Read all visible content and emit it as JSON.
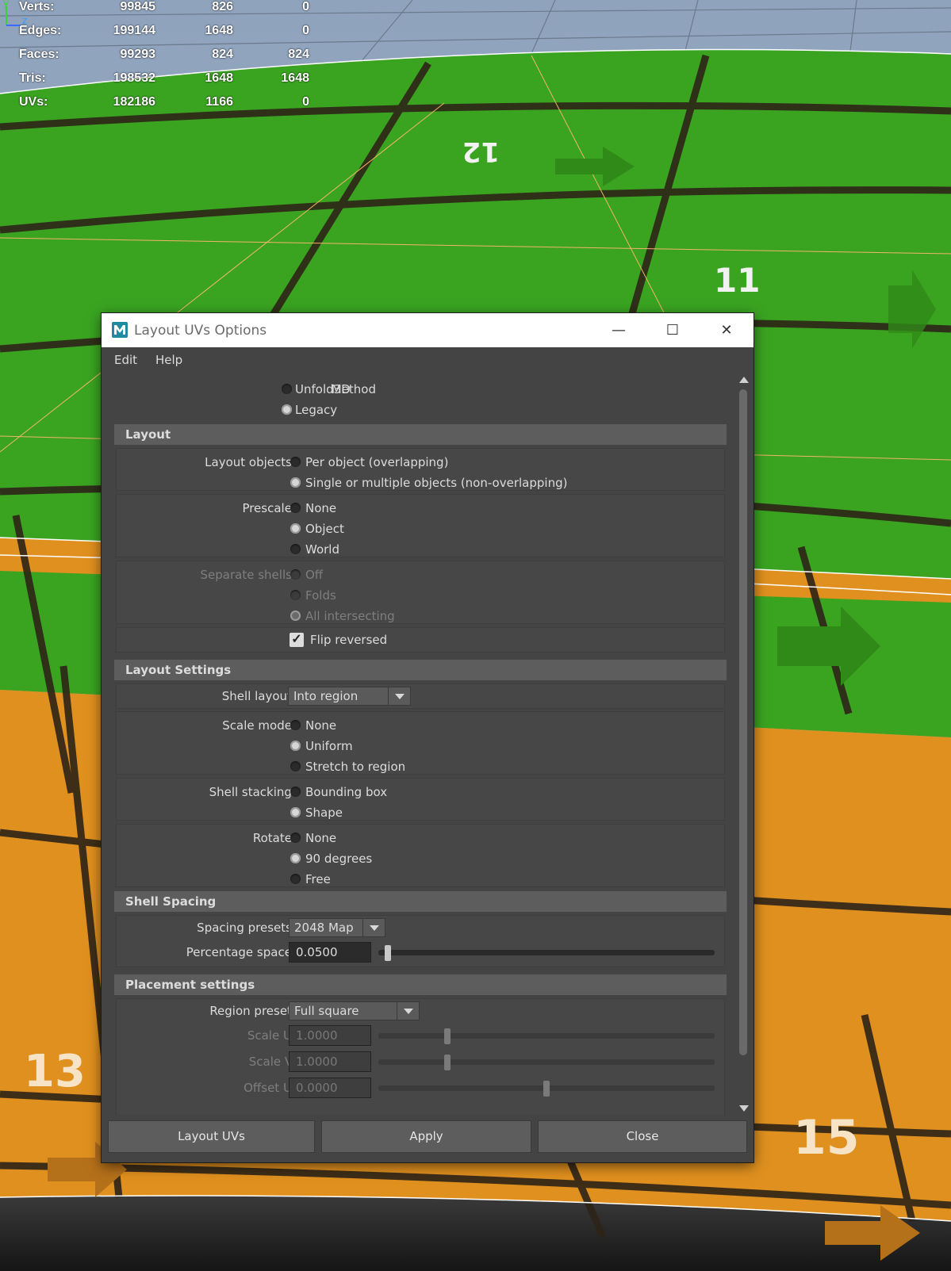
{
  "hud": {
    "rows": [
      {
        "label": "Verts:",
        "v1": "99845",
        "v2": "826",
        "v3": "0"
      },
      {
        "label": "Edges:",
        "v1": "199144",
        "v2": "1648",
        "v3": "0"
      },
      {
        "label": "Faces:",
        "v1": "99293",
        "v2": "824",
        "v3": "824"
      },
      {
        "label": "Tris:",
        "v1": "198532",
        "v2": "1648",
        "v3": "1648"
      },
      {
        "label": "UVs:",
        "v1": "182186",
        "v2": "1166",
        "v3": "0"
      }
    ]
  },
  "viewport": {
    "tile_labels": [
      "12",
      "11",
      "13",
      "15"
    ],
    "axis": {
      "y": "y",
      "z": "z"
    }
  },
  "dialog": {
    "title": "Layout UVs Options",
    "menu": [
      "Edit",
      "Help"
    ],
    "method": {
      "label": "Method",
      "options": [
        "Unfold3D",
        "Legacy"
      ],
      "selected": "Legacy"
    },
    "layout_section": "Layout",
    "layout_objects": {
      "label": "Layout objects:",
      "options": [
        "Per object (overlapping)",
        "Single or multiple objects (non-overlapping)"
      ],
      "selected": 1
    },
    "prescale": {
      "label": "Prescale:",
      "options": [
        "None",
        "Object",
        "World"
      ],
      "selected": 1
    },
    "separate_shells": {
      "label": "Separate shells:",
      "options": [
        "Off",
        "Folds",
        "All intersecting"
      ],
      "selected": 2,
      "disabled": true
    },
    "flip_reversed": {
      "label": "Flip reversed",
      "checked": true
    },
    "layout_settings_section": "Layout Settings",
    "shell_layout": {
      "label": "Shell layout:",
      "value": "Into region"
    },
    "scale_mode": {
      "label": "Scale mode:",
      "options": [
        "None",
        "Uniform",
        "Stretch to region"
      ],
      "selected": 1
    },
    "shell_stacking": {
      "label": "Shell stacking:",
      "options": [
        "Bounding box",
        "Shape"
      ],
      "selected": 1
    },
    "rotate": {
      "label": "Rotate:",
      "options": [
        "None",
        "90 degrees",
        "Free"
      ],
      "selected": 1
    },
    "shell_spacing_section": "Shell Spacing",
    "spacing_presets": {
      "label": "Spacing presets:",
      "value": "2048 Map"
    },
    "percentage_space": {
      "label": "Percentage space:",
      "value": "0.0500",
      "level": 0.02
    },
    "placement_section": "Placement settings",
    "region_preset": {
      "label": "Region preset:",
      "value": "Full square"
    },
    "scale_u": {
      "label": "Scale U:",
      "value": "1.0000",
      "level": 0.2
    },
    "scale_v": {
      "label": "Scale V:",
      "value": "1.0000",
      "level": 0.2
    },
    "offset_u": {
      "label": "Offset U:",
      "value": "0.0000",
      "level": 0.5
    },
    "buttons": {
      "layout": "Layout UVs",
      "apply": "Apply",
      "close": "Close"
    }
  },
  "colors": {
    "green": "#3aa421",
    "orange": "#e0901e",
    "sky": "#8fa3bd",
    "dialog_bg": "#444444",
    "header_bg": "#5d5d5d"
  }
}
